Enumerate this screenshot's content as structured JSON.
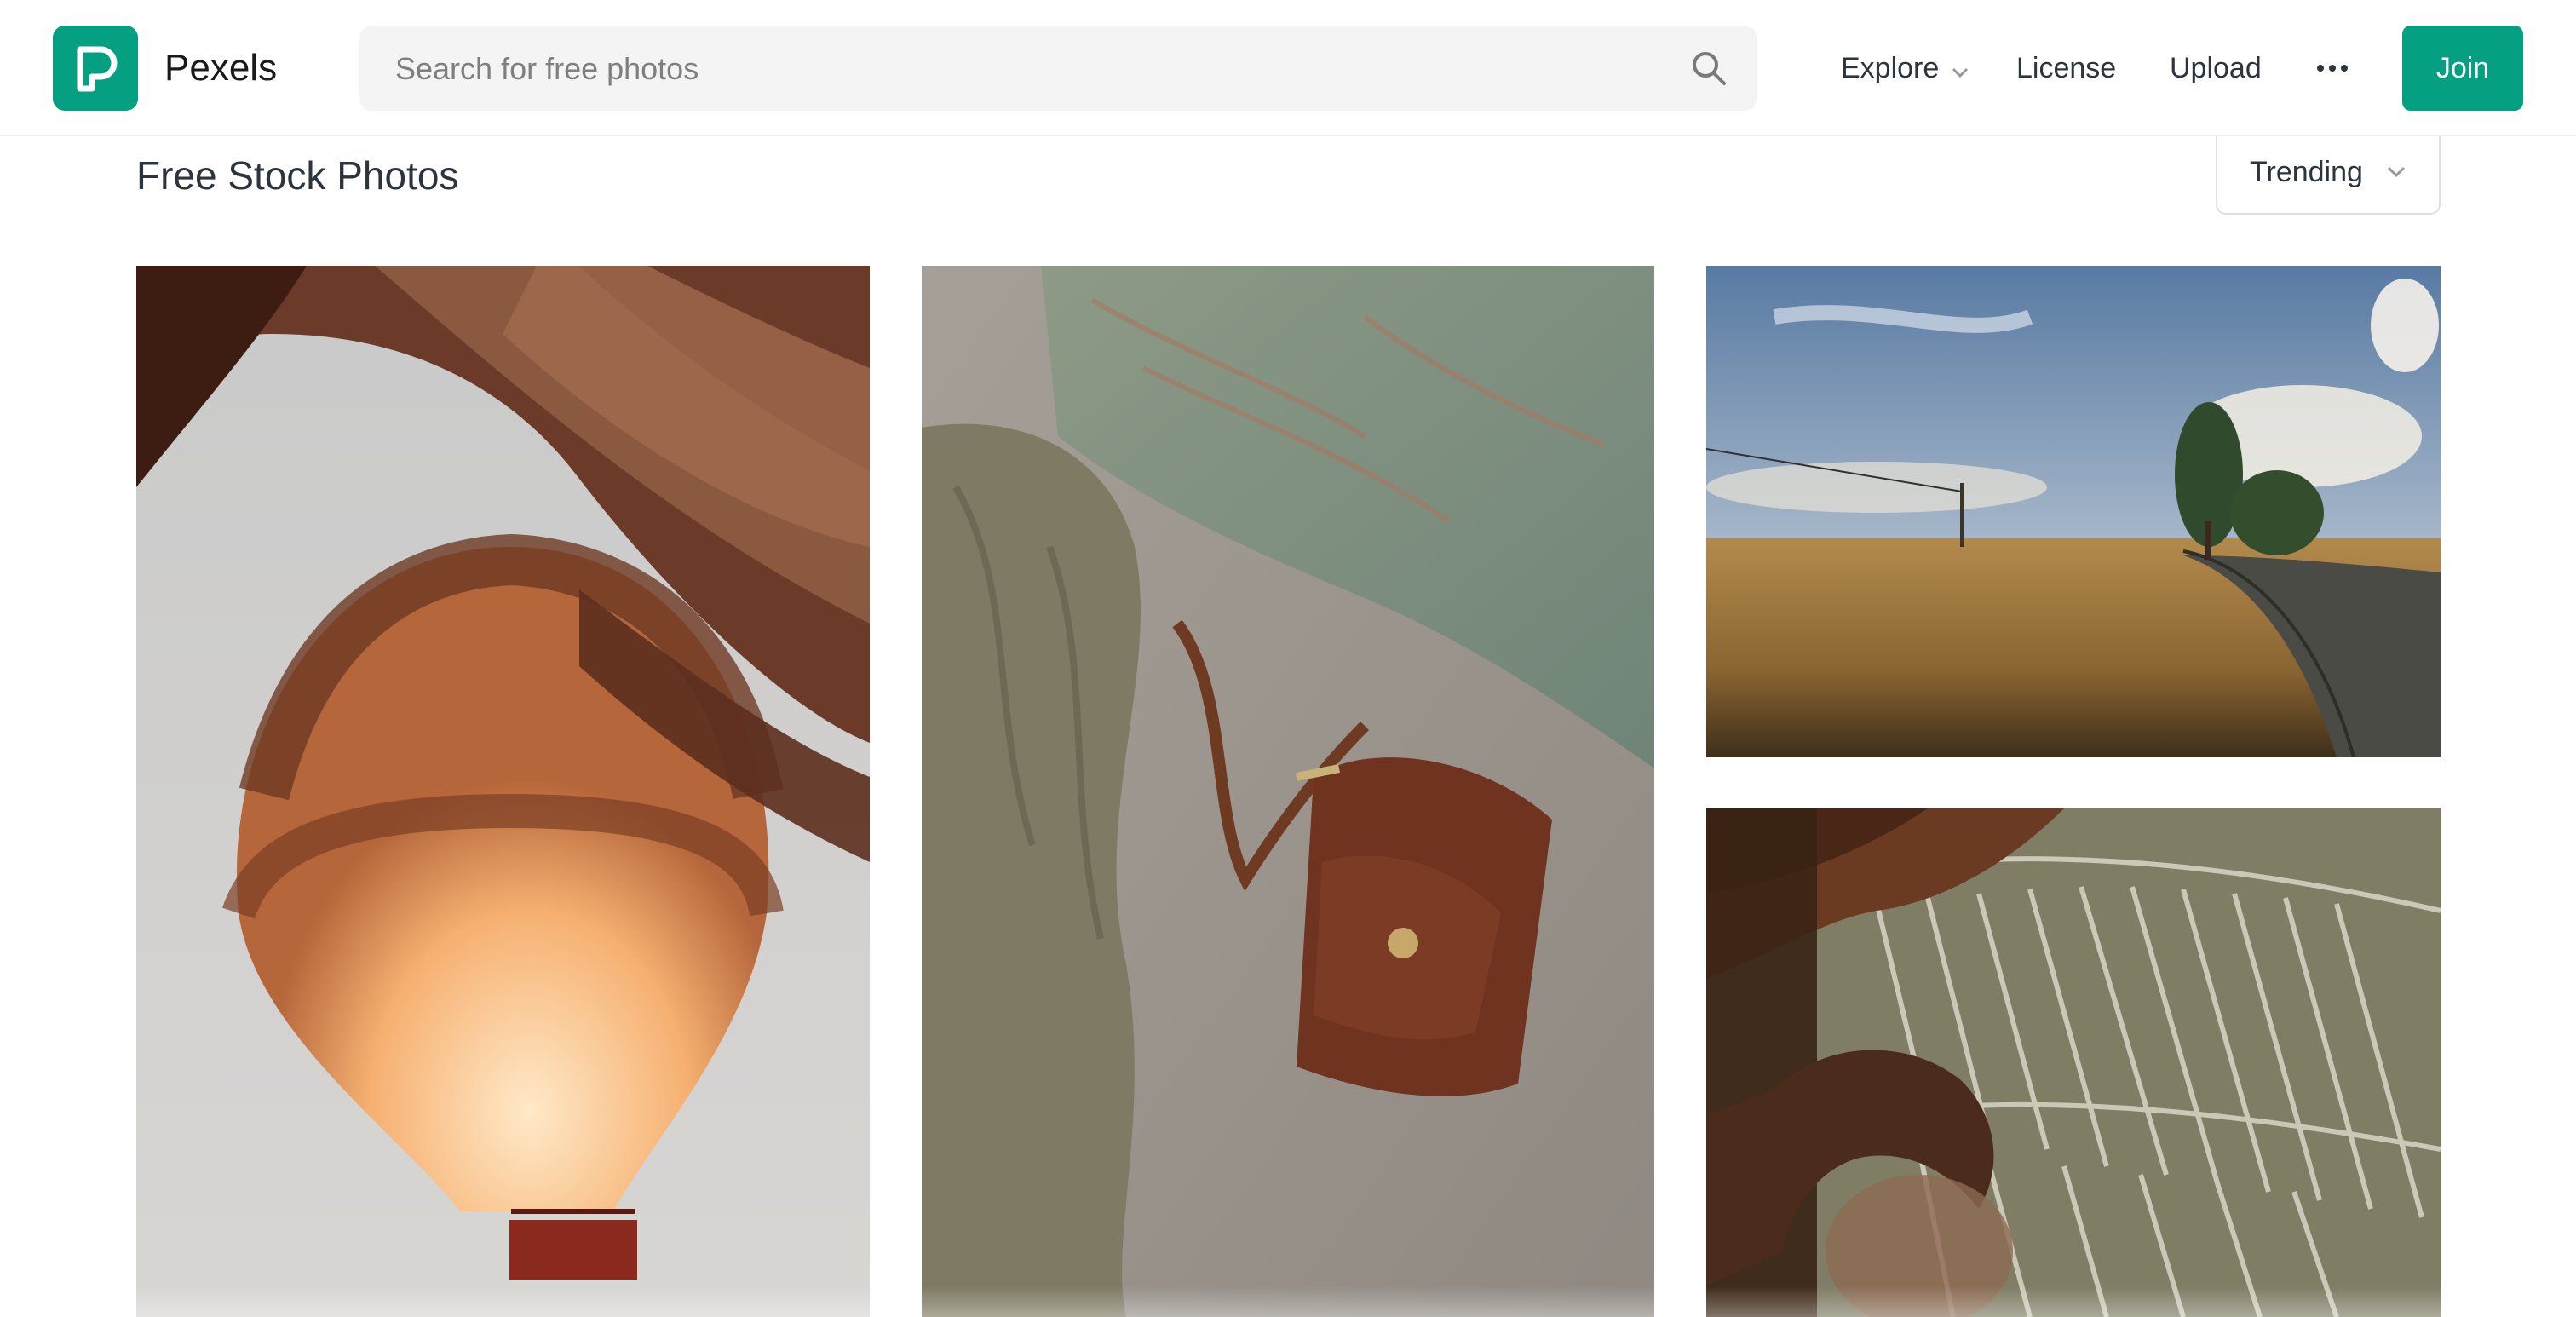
{
  "brand": {
    "name": "Pexels",
    "color": "#05a081",
    "logo_icon": "pexels-p-logo-icon"
  },
  "search": {
    "placeholder": "Search for free photos",
    "value": "",
    "icon": "search-icon"
  },
  "nav": {
    "explore_label": "Explore",
    "license_label": "License",
    "upload_label": "Upload",
    "more_icon": "more-horizontal-icon",
    "join_label": "Join"
  },
  "page": {
    "title": "Free Stock Photos"
  },
  "sort": {
    "selected": "Trending",
    "icon": "chevron-down-icon"
  },
  "photos": [
    {
      "subject": "hot-air-balloon-photo"
    },
    {
      "subject": "leather-bag-on-bed-photo"
    },
    {
      "subject": "countryside-road-field-photo"
    },
    {
      "subject": "palm-leaves-person-photo"
    }
  ]
}
